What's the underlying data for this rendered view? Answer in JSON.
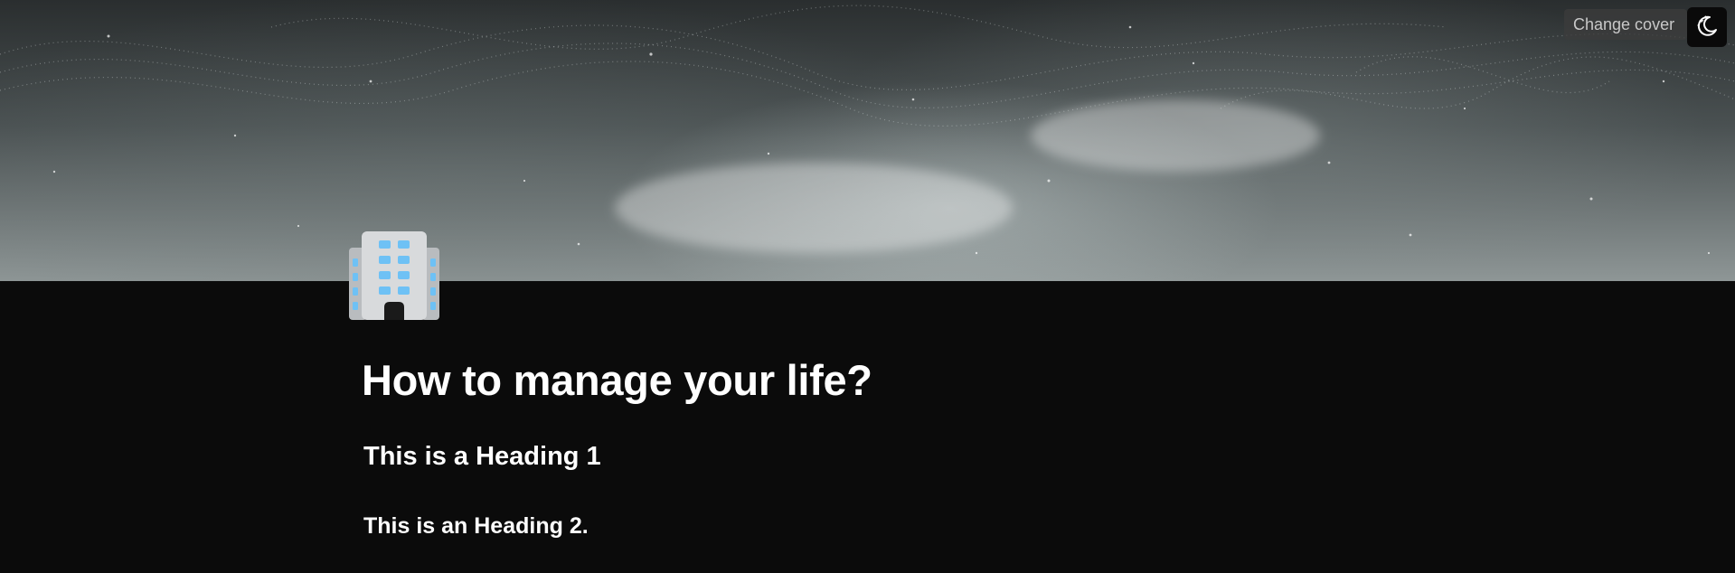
{
  "cover": {
    "change_cover_label": "Change cover"
  },
  "theme_toggle": {
    "icon": "moon-stars-icon"
  },
  "page_icon": {
    "icon": "office-building-icon"
  },
  "page": {
    "title": "How to manage your life?",
    "blocks": [
      {
        "type": "heading_1",
        "text": "This is a Heading 1"
      },
      {
        "type": "heading_2",
        "text": "This is an Heading 2."
      }
    ]
  },
  "colors": {
    "background": "#0b0b0b",
    "text": "#ffffff"
  }
}
